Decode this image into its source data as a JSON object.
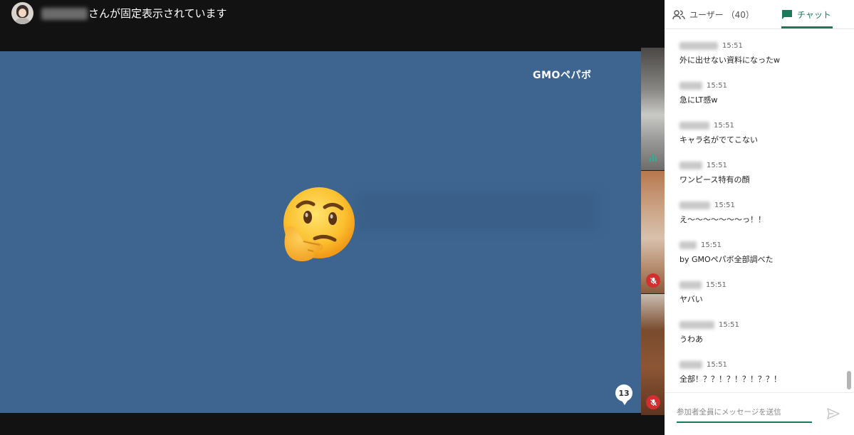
{
  "pinned_banner": {
    "text": "さんが固定表示されています"
  },
  "main_video": {
    "logo_text": "GMOペパボ",
    "participant_badge_count": "13"
  },
  "side_panel": {
    "tabs": [
      {
        "label": "ユーザー （40）",
        "icon": "people-icon",
        "selected": false
      },
      {
        "label": "チャット",
        "icon": "chat-icon",
        "selected": true
      }
    ],
    "accent_color": "#1b7a5a",
    "messages": [
      {
        "time": "15:51",
        "text": "外に出せない資料になったw"
      },
      {
        "time": "15:51",
        "text": "急にLT感w"
      },
      {
        "time": "15:51",
        "text": "キャラ名がでてこない"
      },
      {
        "time": "15:51",
        "text": "ワンピース特有の顔"
      },
      {
        "time": "15:51",
        "text": "え〜〜〜〜〜〜〜っ！！"
      },
      {
        "time": "15:51",
        "text": "by GMOペパボ全部調べた"
      },
      {
        "time": "15:51",
        "text": "ヤバい"
      },
      {
        "time": "15:51",
        "text": "うわあ"
      },
      {
        "time": "15:51",
        "text": "全部！？？！？！？！？？！"
      }
    ],
    "composer": {
      "placeholder": "参加者全員にメッセージを送信"
    }
  },
  "colors": {
    "main_video_bg": "#3d6590",
    "mute_red": "#d23030",
    "speaking_green": "#29b49a"
  }
}
